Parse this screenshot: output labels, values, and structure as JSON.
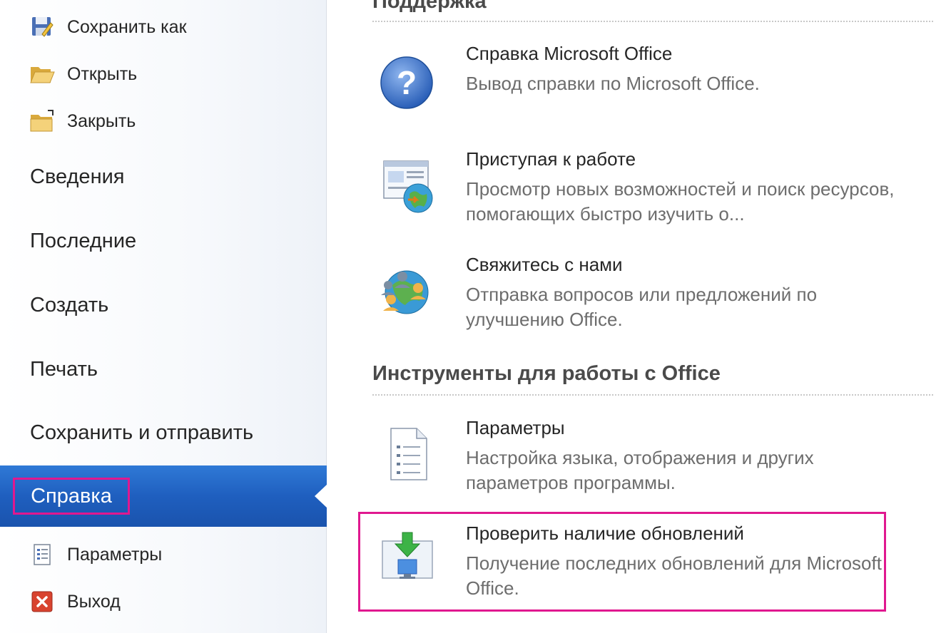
{
  "nav": {
    "top_items": [
      {
        "label": "Сохранить как",
        "icon": "save-as-icon"
      },
      {
        "label": "Открыть",
        "icon": "open-folder-icon"
      },
      {
        "label": "Закрыть",
        "icon": "close-folder-icon"
      }
    ],
    "main_items": [
      {
        "label": "Сведения"
      },
      {
        "label": "Последние"
      },
      {
        "label": "Создать"
      },
      {
        "label": "Печать"
      },
      {
        "label": "Сохранить и отправить"
      }
    ],
    "active_item": {
      "label": "Справка"
    },
    "bottom_items": [
      {
        "label": "Параметры",
        "icon": "options-icon"
      },
      {
        "label": "Выход",
        "icon": "exit-icon"
      }
    ]
  },
  "content": {
    "support_title": "Поддержка",
    "support_items": [
      {
        "title": "Справка Microsoft Office",
        "desc": "Вывод справки по Microsoft Office.",
        "icon": "help-question-icon"
      },
      {
        "title": "Приступая к работе",
        "desc": "Просмотр новых возможностей и поиск ресурсов, помогающих быстро изучить о...",
        "icon": "getting-started-icon"
      },
      {
        "title": "Свяжитесь с нами",
        "desc": "Отправка вопросов или предложений по улучшению Office.",
        "icon": "contact-us-icon"
      }
    ],
    "tools_title": "Инструменты для работы с Office",
    "tools_items": [
      {
        "title": "Параметры",
        "desc": "Настройка языка, отображения и других параметров программы.",
        "icon": "options-document-icon"
      },
      {
        "title": "Проверить наличие обновлений",
        "desc": "Получение последних обновлений для Microsoft Office.",
        "icon": "check-updates-icon"
      }
    ]
  },
  "colors": {
    "accent_blue": "#1f5fbf",
    "highlight_magenta": "#e0188f"
  }
}
